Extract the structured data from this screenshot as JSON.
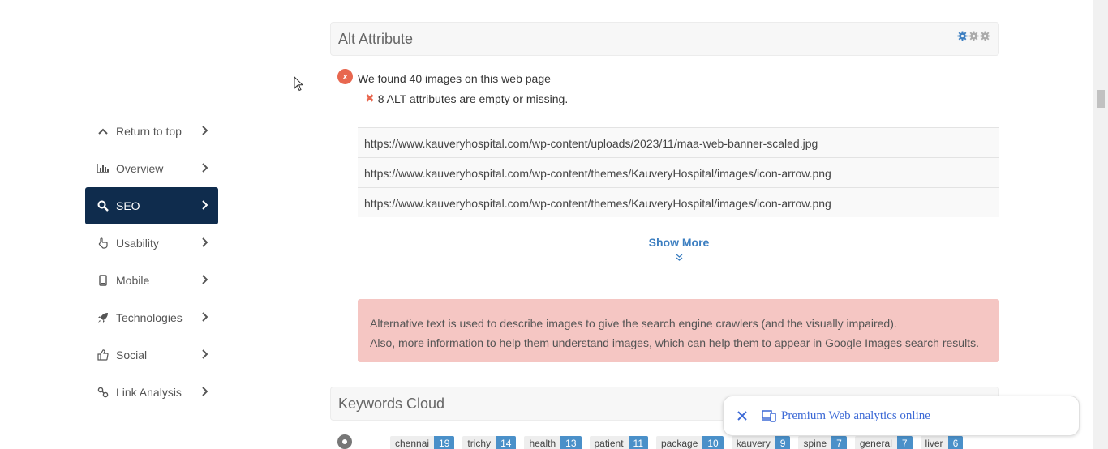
{
  "sidebar": {
    "items": [
      {
        "label": "Return to top",
        "icon": "chevron-up-icon"
      },
      {
        "label": "Overview",
        "icon": "bar-chart-icon"
      },
      {
        "label": "SEO",
        "icon": "search-icon",
        "active": true
      },
      {
        "label": "Usability",
        "icon": "pointer-hand-icon"
      },
      {
        "label": "Mobile",
        "icon": "mobile-icon"
      },
      {
        "label": "Technologies",
        "icon": "rocket-icon"
      },
      {
        "label": "Social",
        "icon": "thumbs-up-icon"
      },
      {
        "label": "Link Analysis",
        "icon": "link-icon"
      }
    ]
  },
  "alt_section": {
    "title": "Alt Attribute",
    "found_text": "We found 40 images on this web page",
    "missing_text": "8 ALT attributes are empty or missing.",
    "urls": [
      "https://www.kauveryhospital.com/wp-content/uploads/2023/11/maa-web-banner-scaled.jpg",
      "https://www.kauveryhospital.com/wp-content/themes/KauveryHospital/images/icon-arrow.png",
      "https://www.kauveryhospital.com/wp-content/themes/KauveryHospital/images/icon-arrow.png"
    ],
    "show_more": "Show More",
    "alert_line1": "Alternative text is used to describe images to give the search engine crawlers (and the visually impaired).",
    "alert_line2": "Also, more information to help them understand images, which can help them to appear in Google Images search results."
  },
  "keywords_section": {
    "title": "Keywords Cloud",
    "keywords": [
      {
        "word": "chennai",
        "count": "19"
      },
      {
        "word": "trichy",
        "count": "14"
      },
      {
        "word": "health",
        "count": "13"
      },
      {
        "word": "patient",
        "count": "11"
      },
      {
        "word": "package",
        "count": "10"
      },
      {
        "word": "kauvery",
        "count": "9"
      },
      {
        "word": "spine",
        "count": "7"
      },
      {
        "word": "general",
        "count": "7"
      },
      {
        "word": "liver",
        "count": "6"
      }
    ]
  },
  "toast": {
    "text": "Premium Web analytics online"
  },
  "colors": {
    "active_nav": "#0f2c4d",
    "alert_bg": "#f5c6c3",
    "link": "#3d7fc1",
    "error": "#e8674f",
    "badge": "#4a90c9"
  }
}
